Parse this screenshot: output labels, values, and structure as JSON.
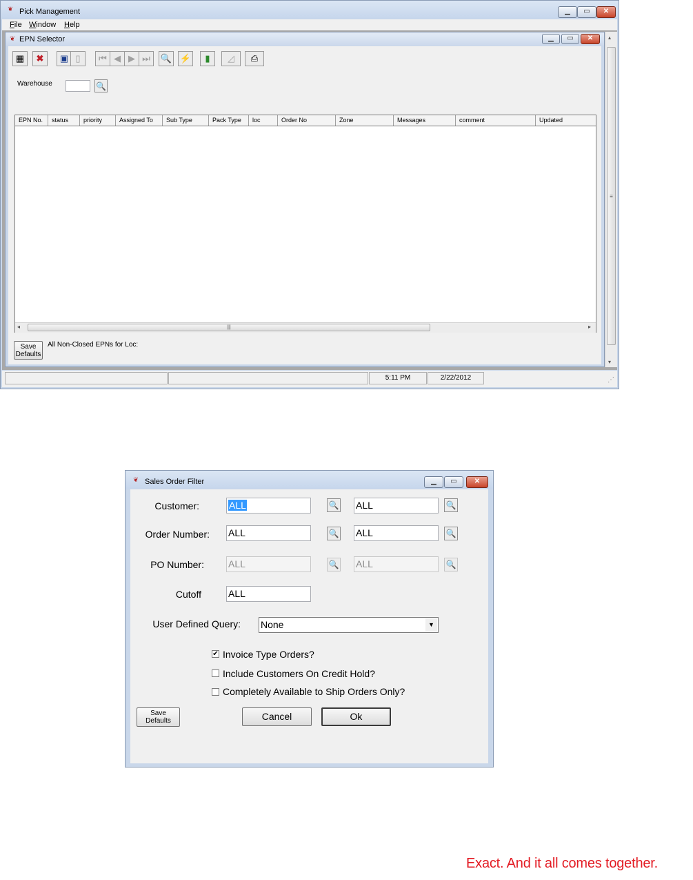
{
  "main_window": {
    "title": "Pick Management",
    "menu": {
      "file": "File",
      "window": "Window",
      "help": "Help"
    },
    "caption_buttons": {
      "minimize": "▁",
      "restore": "▭",
      "close": "✕"
    }
  },
  "epn_selector": {
    "title": "EPN Selector",
    "toolbar": [
      "calculator-icon",
      "delete-icon",
      "save-icon",
      "trash-icon",
      "first-record-icon",
      "previous-record-icon",
      "next-record-icon",
      "last-record-icon",
      "search-icon",
      "lightning-icon",
      "exit-door-icon",
      "chart-icon",
      "print-icon"
    ],
    "warehouse_label": "Warehouse",
    "warehouse_value": "",
    "columns": [
      "EPN No.",
      "status",
      "priority",
      "Assigned To",
      "Sub Type",
      "Pack Type",
      "loc",
      "Order No",
      "Zone",
      "Messages",
      "comment",
      "Updated"
    ],
    "rows": [],
    "save_defaults": [
      "Save",
      "Defaults"
    ],
    "filter_status": "All Non-Closed EPNs for Loc:"
  },
  "statusbar": {
    "time": "5:11 PM",
    "date": "2/22/2012"
  },
  "dialog": {
    "title": "Sales Order Filter",
    "customer": {
      "label": "Customer:",
      "from": "ALL",
      "to": "ALL"
    },
    "order_number": {
      "label": "Order Number:",
      "from": "ALL",
      "to": "ALL"
    },
    "po_number": {
      "label": "PO Number:",
      "from": "ALL",
      "to": "ALL",
      "enabled": false
    },
    "cutoff": {
      "label": "Cutoff",
      "value": "ALL"
    },
    "user_query": {
      "label": "User Defined Query:",
      "value": "None"
    },
    "checkboxes": [
      {
        "label": "Invoice Type Orders?",
        "checked": true
      },
      {
        "label": "Include Customers On Credit Hold?",
        "checked": false
      },
      {
        "label": "Completely Available to Ship Orders Only?",
        "checked": false
      }
    ],
    "save_defaults": [
      "Save",
      "Defaults"
    ],
    "cancel": "Cancel",
    "ok": "Ok"
  },
  "tagline": "Exact. And it all comes together.",
  "colors": {
    "tagline": "#e31b23",
    "selection": "#3399ff",
    "close_button": "#c8442a"
  }
}
